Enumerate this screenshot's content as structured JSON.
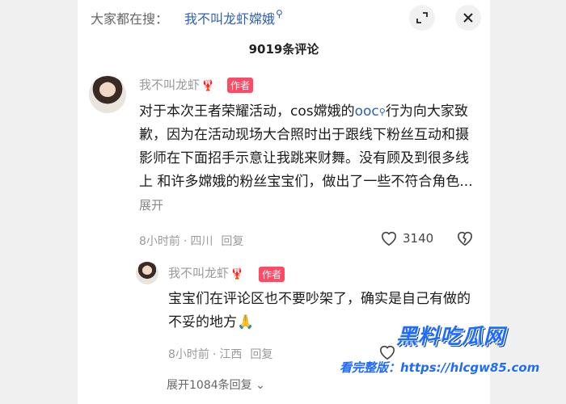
{
  "header": {
    "search_label": "大家都在搜：",
    "search_term": "我不叫龙虾嫦娥",
    "search_icon": "search-icon",
    "expand_icon": "expand-icon",
    "close_icon": "close-icon"
  },
  "comments_count": "9019条评论",
  "comment": {
    "username": "我不叫龙虾",
    "user_badge_emoji": "🦞",
    "author_badge": "作者",
    "text_before_link": "对于本次王者荣耀活动，cos嫦娥的",
    "link_text": "ooc",
    "text_after_link": "行为向大家致歉，因为在活动现场大合照时出于跟线下粉丝互动和摄影师在下面招手示意让我跳来财舞。没有顾及到很多线上 和许多嫦娥的粉丝宝宝们，做出了一些不符合角色...",
    "expand_label": "展开",
    "time": "8小时前",
    "location": "四川",
    "reply_label": "回复",
    "likes": "3140"
  },
  "reply": {
    "username": "我不叫龙虾",
    "user_badge_emoji": "🦞",
    "author_badge": "作者",
    "text": "宝宝们在评论区也不要吵架了，确实是自己有做的不妥的地方🙏",
    "time": "8小时前",
    "location": "江西",
    "reply_label": "回复"
  },
  "expand_replies": "展开1084条回复",
  "watermark": {
    "brand": "黑料吃瓜网",
    "note": "看完整版：https://hlcgw85.com"
  }
}
